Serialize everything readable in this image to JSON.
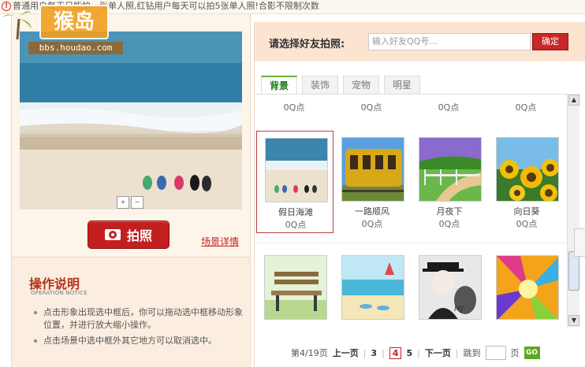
{
  "notice": {
    "text": "普通用户每天只能拍一张单人照,红钻用户每天可以拍5张单人照!合影不限制次数"
  },
  "watermark": {
    "logo_text": "猴岛",
    "url": "bbs.houdao.com"
  },
  "left": {
    "photo_button_label": "拍照",
    "scene_link": "场景详情",
    "instructions": {
      "title": "操作说明",
      "subtitle": "OPERATION NOTICE",
      "items": [
        "点击形象出现选中框后，你可以拖动选中框移动形象位置，并进行放大缩小操作。",
        "点击场景中选中框外其它地方可以取消选中。"
      ]
    }
  },
  "right": {
    "friend_label": "请选择好友拍照:",
    "friend_placeholder": "输入好友QQ号...",
    "confirm_label": "确定",
    "tabs": [
      {
        "label": "背景",
        "active": true
      },
      {
        "label": "装饰",
        "active": false
      },
      {
        "label": "宠物",
        "active": false
      },
      {
        "label": "明星",
        "active": false
      }
    ],
    "top_prices": [
      "0Q点",
      "0Q点",
      "0Q点",
      "0Q点"
    ],
    "items": [
      {
        "name": "假日海滩",
        "price": "0Q点",
        "selected": true
      },
      {
        "name": "一路顺风",
        "price": "0Q点",
        "selected": false
      },
      {
        "name": "月夜下",
        "price": "0Q点",
        "selected": false
      },
      {
        "name": "向日葵",
        "price": "0Q点",
        "selected": false
      },
      {
        "name": "",
        "price": "",
        "selected": false
      },
      {
        "name": "",
        "price": "",
        "selected": false
      },
      {
        "name": "",
        "price": "",
        "selected": false
      },
      {
        "name": "",
        "price": "",
        "selected": false
      }
    ],
    "pager": {
      "page_info": "第4/19页",
      "prev": "上一页",
      "pages": [
        "3",
        "4",
        "5"
      ],
      "current": "4",
      "next": "下一页",
      "jump_label": "跳到",
      "page_unit": "页",
      "go": "GO"
    }
  },
  "colors": {
    "accent_red": "#c41f1f",
    "tab_green": "#6cb02b",
    "panel_bg": "#fdf4ea"
  }
}
